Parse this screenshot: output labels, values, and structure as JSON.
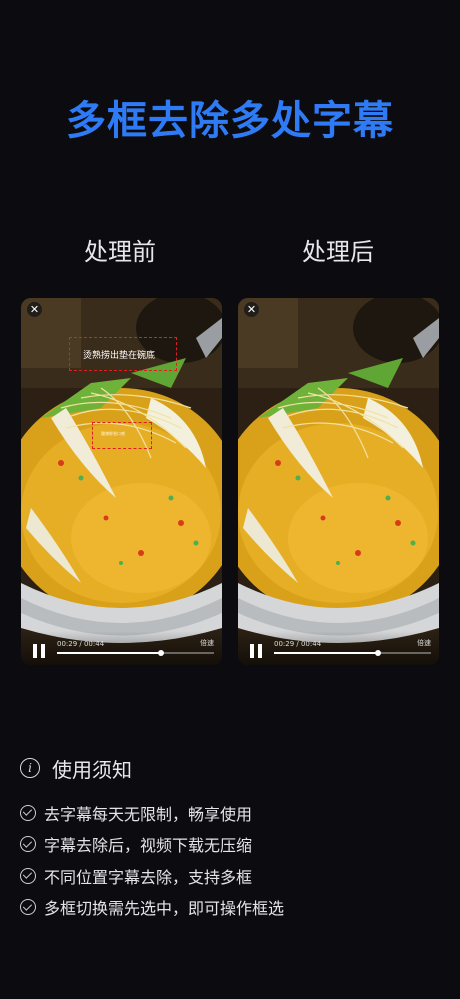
{
  "headline": "多框去除多处字幕",
  "columns": {
    "before_label": "处理前",
    "after_label": "处理后"
  },
  "players": {
    "before": {
      "close_glyph": "✕",
      "time": "00:29 / 00:44",
      "speed": "倍速",
      "progress": 0.66,
      "subtitle_main": "烫熟捞出垫在碗底",
      "subtitle_small": "酸辣鲜香口感"
    },
    "after": {
      "close_glyph": "✕",
      "time": "00:29 / 00:44",
      "speed": "倍速",
      "progress": 0.66
    }
  },
  "notes": {
    "title": "使用须知",
    "info_glyph": "i",
    "items": [
      "去字幕每天无限制，畅享使用",
      "字幕去除后，视频下载无压缩",
      "不同位置字幕去除，支持多框",
      "多框切换需先选中，即可操作框选"
    ]
  },
  "colors": {
    "headline": "#2f7bf6",
    "background": "#0b0b10",
    "selection_box": "#e02020"
  }
}
